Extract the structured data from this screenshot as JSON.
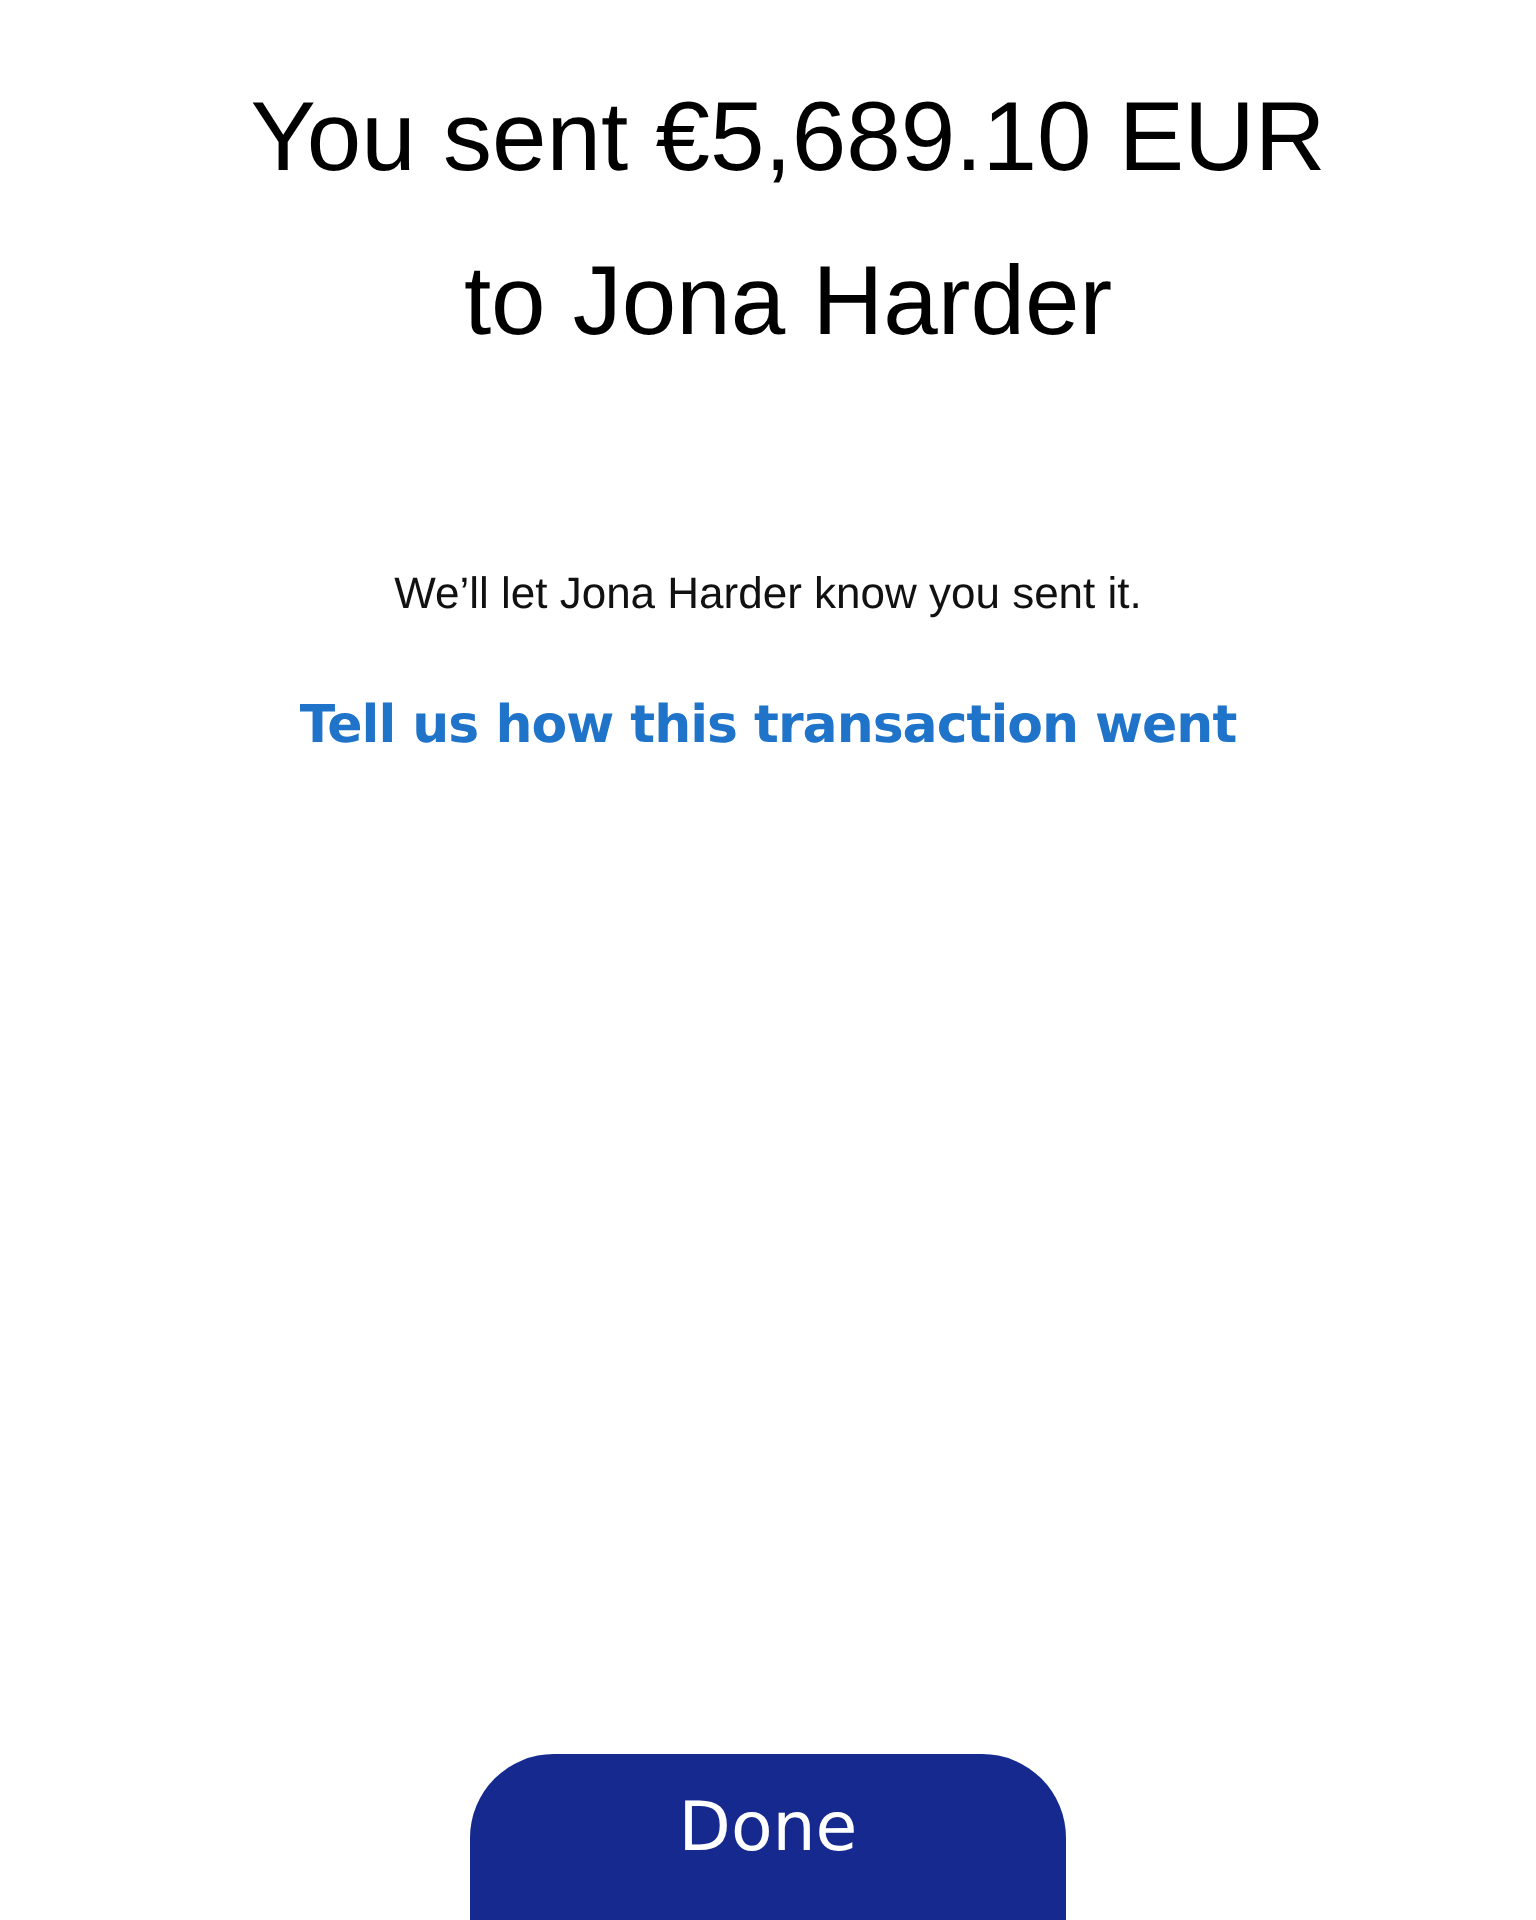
{
  "title": {
    "lines": [
      "You sent €5,689.10 EUR",
      "to Jona Harder"
    ]
  },
  "message": "We’ll let Jona Harder know you sent it.",
  "feedback_link": "Tell us how this transaction went",
  "done_button": "Done"
}
